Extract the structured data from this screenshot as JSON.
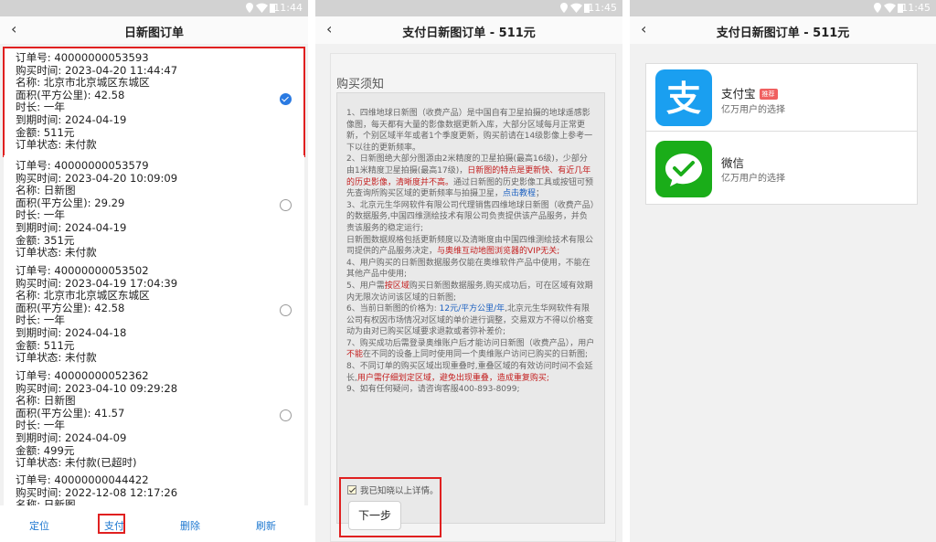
{
  "status_bar": {
    "time1": "11:44",
    "time2": "11:45",
    "time3": "11:45"
  },
  "screen1": {
    "title": "日新图订单",
    "orders": [
      {
        "order_no": "订单号: 40000000053593",
        "buy_time": "购买时间: 2023-04-20 11:44:47",
        "name": "名称: 北京市北京城区东城区",
        "area": "面积(平方公里): 42.58",
        "duration": "时长: 一年",
        "expire": "到期时间: 2024-04-19",
        "amount": "金额: 511元",
        "state": "订单状态: 未付款",
        "selected": true
      },
      {
        "order_no": "订单号: 40000000053579",
        "buy_time": "购买时间: 2023-04-20 10:09:09",
        "name": "名称: 日新图",
        "area": "面积(平方公里): 29.29",
        "duration": "时长: 一年",
        "expire": "到期时间: 2024-04-19",
        "amount": "金额: 351元",
        "state": "订单状态: 未付款",
        "selected": false
      },
      {
        "order_no": "订单号: 40000000053502",
        "buy_time": "购买时间: 2023-04-19 17:04:39",
        "name": "名称: 北京市北京城区东城区",
        "area": "面积(平方公里): 42.58",
        "duration": "时长: 一年",
        "expire": "到期时间: 2024-04-18",
        "amount": "金额: 511元",
        "state": "订单状态: 未付款",
        "selected": false
      },
      {
        "order_no": "订单号: 40000000052362",
        "buy_time": "购买时间: 2023-04-10 09:29:28",
        "name": "名称: 日新图",
        "area": "面积(平方公里): 41.57",
        "duration": "时长: 一年",
        "expire": "到期时间: 2024-04-09",
        "amount": "金额: 499元",
        "state": "订单状态: 未付款(已超时)",
        "selected": false
      },
      {
        "order_no": "订单号: 40000000044422",
        "buy_time": "购买时间: 2022-12-08 12:17:26",
        "name": "名称: 日新图",
        "selected": false
      }
    ],
    "actions": {
      "locate": "定位",
      "pay": "支付",
      "delete": "删除",
      "refresh": "刷新"
    }
  },
  "screen2": {
    "title": "支付日新图订单 - 511元",
    "notice_title": "购买须知",
    "notice": {
      "p1": "1、四维地球日新图（收费产品）是中国自有卫星拍摄的地球遥感影像图，每天都有大量的影像数据更新入库，大部分区域每月正常更新，个别区域半年或者1个季度更新，购买前请在14级影像上参考一下以往的更新频率。",
      "p2a": "2、日新图绝大部分图源由2米精度的卫星拍摄(最高16级)，少部分由1米精度卫星拍摄(最高17级)，",
      "p2b": "日新图的特点是更新快、有近几年的历史影像，清晰度并不高。",
      "p2c": "通过日新图的历史影像工具或按钮可预先查询所购买区域的更新频率与拍摄卫星，",
      "p2d": "点击教程",
      "p2e": "；",
      "p3a": "3、北京元生华网软件有限公司代理销售四维地球日新图（收费产品）的数据服务,中国四维测绘技术有限公司负责提供该产品服务，并负责该服务的稳定运行;",
      "p3b": "日新图数据规格包括更新频度以及清晰度由中国四维测绘技术有限公司提供的产品服务决定，",
      "p3c": "与奥维互动地图浏览器的VIP无关;",
      "p4": "4、用户购买的日新图数据服务仅能在奥维软件产品中使用，不能在其他产品中使用;",
      "p5a": "5、用户需",
      "p5b": "按区域",
      "p5c": "购买日新图数据服务,购买成功后，可在区域有效期内无限次访问该区域的日新图;",
      "p6a": "6、当前日新图的价格为: ",
      "p6b": "12元/平方公里/年",
      "p6c": ",北京元生华网软件有限公司有权因市场情况对区域的单价进行调整，交易双方不得以价格变动为由对已购买区域要求退款或者弥补差价;",
      "p7a": "7、购买成功后需登录奥维账户后才能访问日新图（收费产品），用户",
      "p7b": "不能",
      "p7c": "在不同的设备上同时使用同一个奥维账户访问已购买的日新图;",
      "p8a": "8、不同订单的购买区域出现重叠时,重叠区域的有效访问时间不会延长,",
      "p8b": "用户需仔细划定区域，避免出现重叠，造成重复购买;",
      "p9": "9、如有任何疑问，请咨询客服400-893-8099;"
    },
    "agree_label": "我已知晓以上详情。",
    "next_label": "下一步"
  },
  "screen3": {
    "title": "支付日新图订单 - 511元",
    "methods": [
      {
        "name": "支付宝",
        "badge": "推荐",
        "sub": "亿万用户的选择",
        "icon": "alipay-icon",
        "color": "#1a9ff0"
      },
      {
        "name": "微信",
        "sub": "亿万用户的选择",
        "icon": "wechat-icon",
        "color": "#1aad19"
      }
    ]
  }
}
